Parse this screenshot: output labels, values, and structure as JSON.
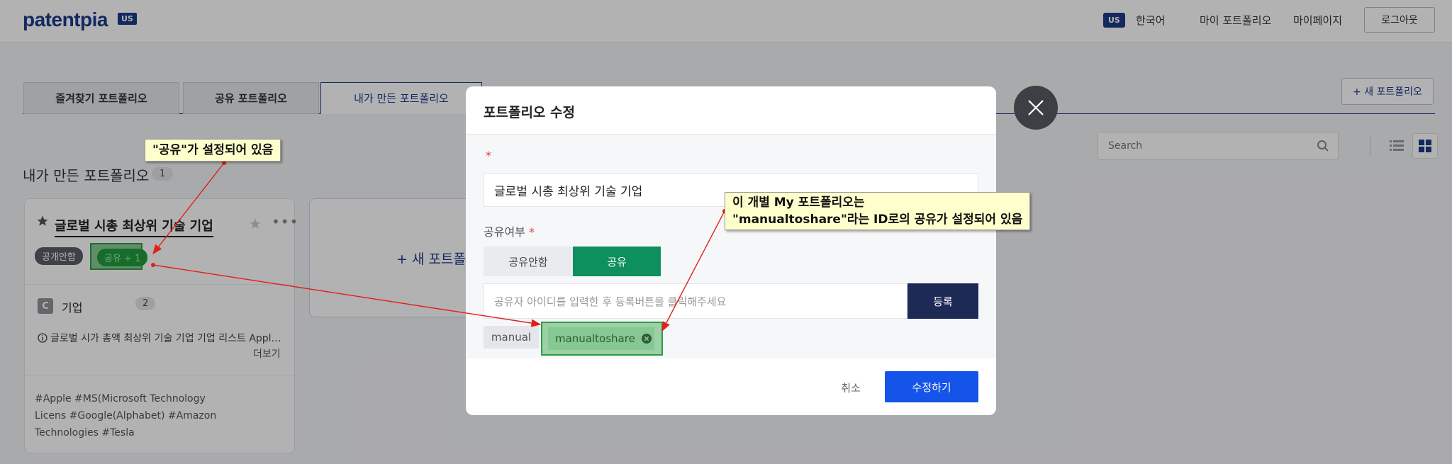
{
  "header": {
    "logo": "patentpia",
    "logo_badge": "US",
    "lang_badge": "US",
    "lang": "한국어",
    "nav": [
      "마이 포트폴리오",
      "마이페이지"
    ],
    "logout": "로그아웃"
  },
  "tabs": [
    "즐겨찾기 포트폴리오",
    "공유 포트폴리오",
    "내가 만든 포트폴리오"
  ],
  "new_portfolio_button": "+ 새 포트폴리오",
  "search": {
    "placeholder": "Search"
  },
  "section": {
    "title": "내가 만든 포트폴리오",
    "count": "1"
  },
  "card": {
    "title": "글로벌 시총 최상위 기술 기업",
    "badge_private": "공개안함",
    "badge_share": "공유 + 1",
    "corp_icon": "C",
    "corp_label": "기업",
    "corp_count": "2",
    "info": "글로벌 시가 총액 최상위 기술 기업 기업 리스트 Appl…",
    "more": "더보기",
    "tags": "#Apple #MS(Microsoft Technology Licens #Google(Alphabet) #Amazon Technologies #Tesla"
  },
  "new_card_label": "+ 새 포트폴",
  "modal": {
    "title": "포트폴리오 수정",
    "required_mark": "*",
    "name_value": "글로벌 시총 최상위 기술 기업",
    "share_label": "공유여부",
    "toggle_off": "공유안함",
    "toggle_on": "공유",
    "sharer_placeholder": "공유자 아이디를 입력한 후 등록버튼을 클릭해주세요",
    "register": "등록",
    "chips": [
      "manual",
      "manualtoshare"
    ],
    "cancel": "취소",
    "save": "수정하기"
  },
  "callouts": {
    "one": "\"공유\"가 설정되어 있음",
    "two_line1": "이 개별 My 포트폴리오는",
    "two_line2": "\"manualtoshare\"라는 ID로의 공유가 설정되어 있음"
  },
  "colors": {
    "brand": "#1e3a8a",
    "share_green": "#0e8f5e",
    "save_blue": "#1554e8",
    "annotation_arrow": "#e0201c",
    "callout_bg": "#ffffcc"
  }
}
